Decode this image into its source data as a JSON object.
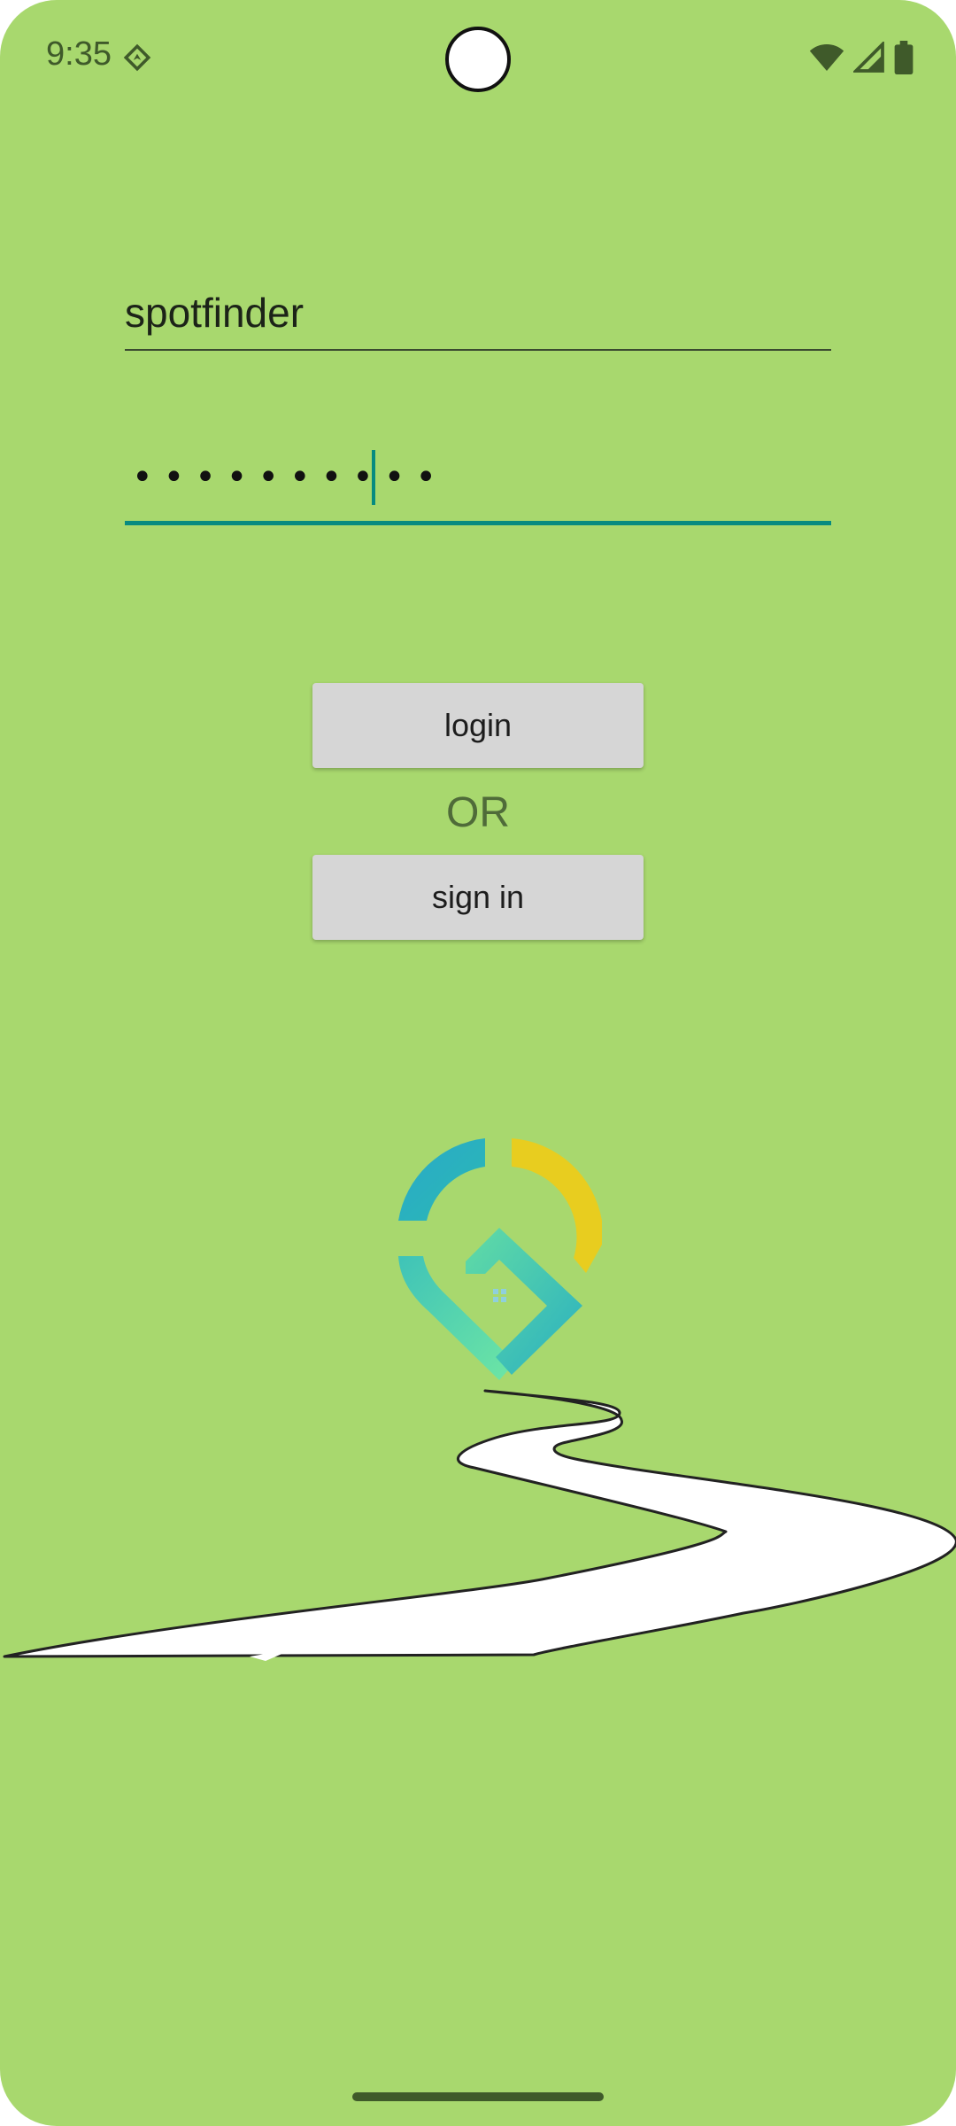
{
  "status_bar": {
    "time": "9:35",
    "location_icon": "location-arrow-icon",
    "wifi_icon": "wifi-icon",
    "signal_icon": "cell-signal-icon",
    "battery_icon": "battery-icon"
  },
  "login_form": {
    "username_value": "spotfinder",
    "password_masked": "••••••••••",
    "login_label": "login",
    "or_label": "OR",
    "signin_label": "sign in"
  },
  "colors": {
    "background": "#a8d86e",
    "accent": "#078b80",
    "button": "#d6d6d6",
    "logo_blue": "#27afc7",
    "logo_yellow": "#e8d02a",
    "logo_green": "#5fd7a0"
  }
}
